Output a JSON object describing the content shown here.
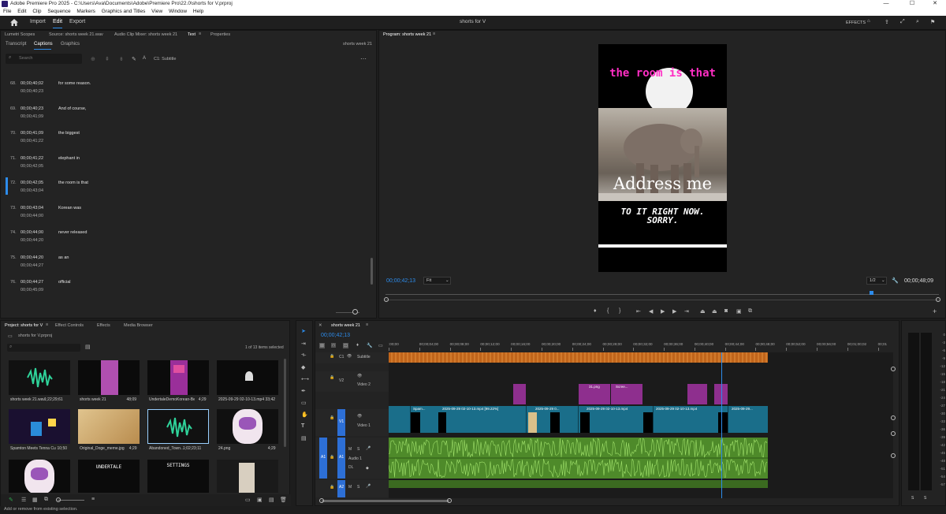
{
  "titlebar": {
    "title": "Adobe Premiere Pro 2025 - C:\\Users\\Ava\\Documents\\Adobe\\Premiere Pro\\22.0\\shorts for V.prproj",
    "minimize": "—",
    "maximize": "☐",
    "close": "✕"
  },
  "menu": [
    "File",
    "Edit",
    "Clip",
    "Sequence",
    "Markers",
    "Graphics and Titles",
    "View",
    "Window",
    "Help"
  ],
  "header": {
    "home_icon": "home-icon",
    "tabs": [
      "Import",
      "Edit",
      "Export"
    ],
    "active_tab": "Edit",
    "project_title": "shorts for V",
    "effects_label": "EFFECTS"
  },
  "left_panel": {
    "tabs": [
      "Lumetri Scopes",
      "Source: shorts week 21.wav",
      "Audio Clip Mixer: shorts week 21",
      "Text",
      "Properties"
    ],
    "subtabs": [
      "Transcript",
      "Captions",
      "Graphics"
    ],
    "sequence_label": "shorts week 21",
    "search_placeholder": "Search",
    "track_label": "C1: Subtitle",
    "captions": [
      {
        "num": "68.",
        "in": "00;00;40;02",
        "out": "00;00;40;23",
        "text": "for some reason."
      },
      {
        "num": "69.",
        "in": "00;00;40;23",
        "out": "00;00;41;09",
        "text": "And of course,"
      },
      {
        "num": "70.",
        "in": "00;00;41;09",
        "out": "00;00;41;22",
        "text": "the biggest"
      },
      {
        "num": "71.",
        "in": "00;00;41;22",
        "out": "00;00;42;05",
        "text": "elephant in"
      },
      {
        "num": "72.",
        "in": "00;00;42;05",
        "out": "00;00;43;04",
        "text": "the room is that"
      },
      {
        "num": "73.",
        "in": "00;00;43;04",
        "out": "00;00;44;00",
        "text": "Korean was"
      },
      {
        "num": "74.",
        "in": "00;00;44;00",
        "out": "00;00;44;20",
        "text": "never released"
      },
      {
        "num": "75.",
        "in": "00;00;44;20",
        "out": "00;00;44;27",
        "text": "as an"
      },
      {
        "num": "76.",
        "in": "00;00;44;27",
        "out": "00;00;45;09",
        "text": "official"
      }
    ],
    "active_caption_index": 4
  },
  "program_monitor": {
    "title": "Program: shorts week 21",
    "video_top_text": "the room is that",
    "video_mid_text": "Address me",
    "video_bottom_text": "TO IT RIGHT NOW. SORRY.",
    "timecode": "00;00;42;13",
    "fit": "Fit",
    "resolution": "1/2",
    "duration": "00;00;48;09",
    "playhead_fraction": 0.878
  },
  "project_panel": {
    "tabs": [
      "Project: shorts for V",
      "Effect Controls",
      "Effects",
      "Media Browser"
    ],
    "project_file": "shorts for V.prproj",
    "selection_info": "1 of 13 items selected",
    "items": [
      {
        "name": "shorts week 21.wav",
        "dur": "1;22;29;61",
        "kind": "audio"
      },
      {
        "name": "shorts week 21",
        "dur": "48;09",
        "kind": "purple"
      },
      {
        "name": "UndertaleDemoKorean-Beg...",
        "dur": "4;29",
        "kind": "purple2"
      },
      {
        "name": "2025-09-29 02-10-13.mp4",
        "dur": "33;42",
        "kind": "dark"
      },
      {
        "name": "Spamton Meets Tenna Cu...",
        "dur": "10;50",
        "kind": "dark2"
      },
      {
        "name": "Original_Doge_meme.jpg",
        "dur": "4;29",
        "kind": "doge"
      },
      {
        "name": "Abandoned_Town...",
        "dur": "1;02;23;11",
        "kind": "audio"
      },
      {
        "name": "24.png",
        "dur": "4;29",
        "kind": "char"
      },
      {
        "name": "",
        "dur": "",
        "kind": "char2"
      },
      {
        "name": "",
        "dur": "",
        "kind": "undertale"
      },
      {
        "name": "",
        "dur": "",
        "kind": "settings"
      },
      {
        "name": "",
        "dur": "",
        "kind": "figure"
      }
    ],
    "undertale_label": "UNDERTALE",
    "settings_label": "SETTINGS"
  },
  "timeline": {
    "sequence_tab": "shorts week 21",
    "timecode": "00;00;42;13",
    "ruler": [
      ":00;00",
      "00;00;04;00",
      "00;00;08;00",
      "00;00;12;00",
      "00;00;16;00",
      "00;00;20;00",
      "00;00;24;00",
      "00;00;28;00",
      "00;00;32;00",
      "00;00;36;00",
      "00;00;40;00",
      "00;00;44;00",
      "00;00;48;00",
      "00;00;52;00",
      "00;00;56;00",
      "00;01;00;02",
      "00;01"
    ],
    "tracks": [
      {
        "id": "C1",
        "name": "Subtitle"
      },
      {
        "id": "V2",
        "name": "Video 2"
      },
      {
        "id": "V1",
        "name": "Video 1"
      },
      {
        "id": "A1",
        "name": "Audio 1"
      },
      {
        "id": "A2",
        "name": ""
      }
    ],
    "v1_clips": [
      "Spam...",
      "2025-09-29 02-10-13.mp4 [99.22%]",
      "2025-09-29 0...",
      "2025-09-29 02-10-13.mp4",
      "2025-09-29 02-10-13.mp4",
      "2025-09-29..."
    ],
    "v2_clips": [
      "31.png",
      "Scree..."
    ],
    "audio_label": "DL"
  },
  "meter_scale": [
    "0",
    "-3",
    "-6",
    "-9",
    "-12",
    "-15",
    "-18",
    "-21",
    "-24",
    "-27",
    "-30",
    "-33",
    "-36",
    "-39",
    "-42",
    "-45",
    "-48",
    "-51",
    "-54",
    "-57"
  ],
  "meter_bottom": [
    "S",
    "S"
  ],
  "status": "Add or remove from existing selection.",
  "colors": {
    "accent": "#2d8ceb",
    "subtitle": "#c0651b",
    "video": "#1a6e8a",
    "purple": "#8e2f8e",
    "audio": "#4e8a2a"
  }
}
